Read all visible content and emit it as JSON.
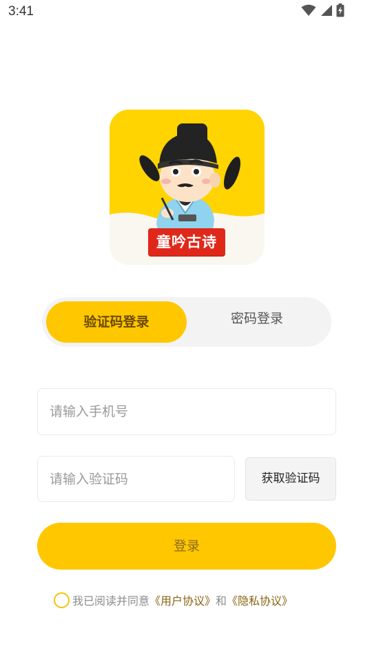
{
  "status_bar": {
    "time": "3:41",
    "icons": [
      "wifi-icon",
      "signal-icon",
      "battery-charging-icon"
    ]
  },
  "logo": {
    "badge_text": "童吟古诗",
    "background_color": "#FFD400",
    "badge_color": "#E0281A"
  },
  "tabs": {
    "sms_login": "验证码登录",
    "password_login": "密码登录",
    "active": "sms_login"
  },
  "form": {
    "phone_placeholder": "请输入手机号",
    "phone_value": "",
    "code_placeholder": "请输入验证码",
    "code_value": "",
    "get_code_label": "获取验证码"
  },
  "login_button": {
    "label": "登录"
  },
  "agreement": {
    "checked": false,
    "prefix": "我已阅读并同意",
    "user_agreement": "《用户协议》",
    "conjunction": "和",
    "privacy_policy": "《隐私协议》"
  },
  "colors": {
    "accent": "#FFC700",
    "link": "#8A6212",
    "tab_track": "#F3F3F3"
  }
}
